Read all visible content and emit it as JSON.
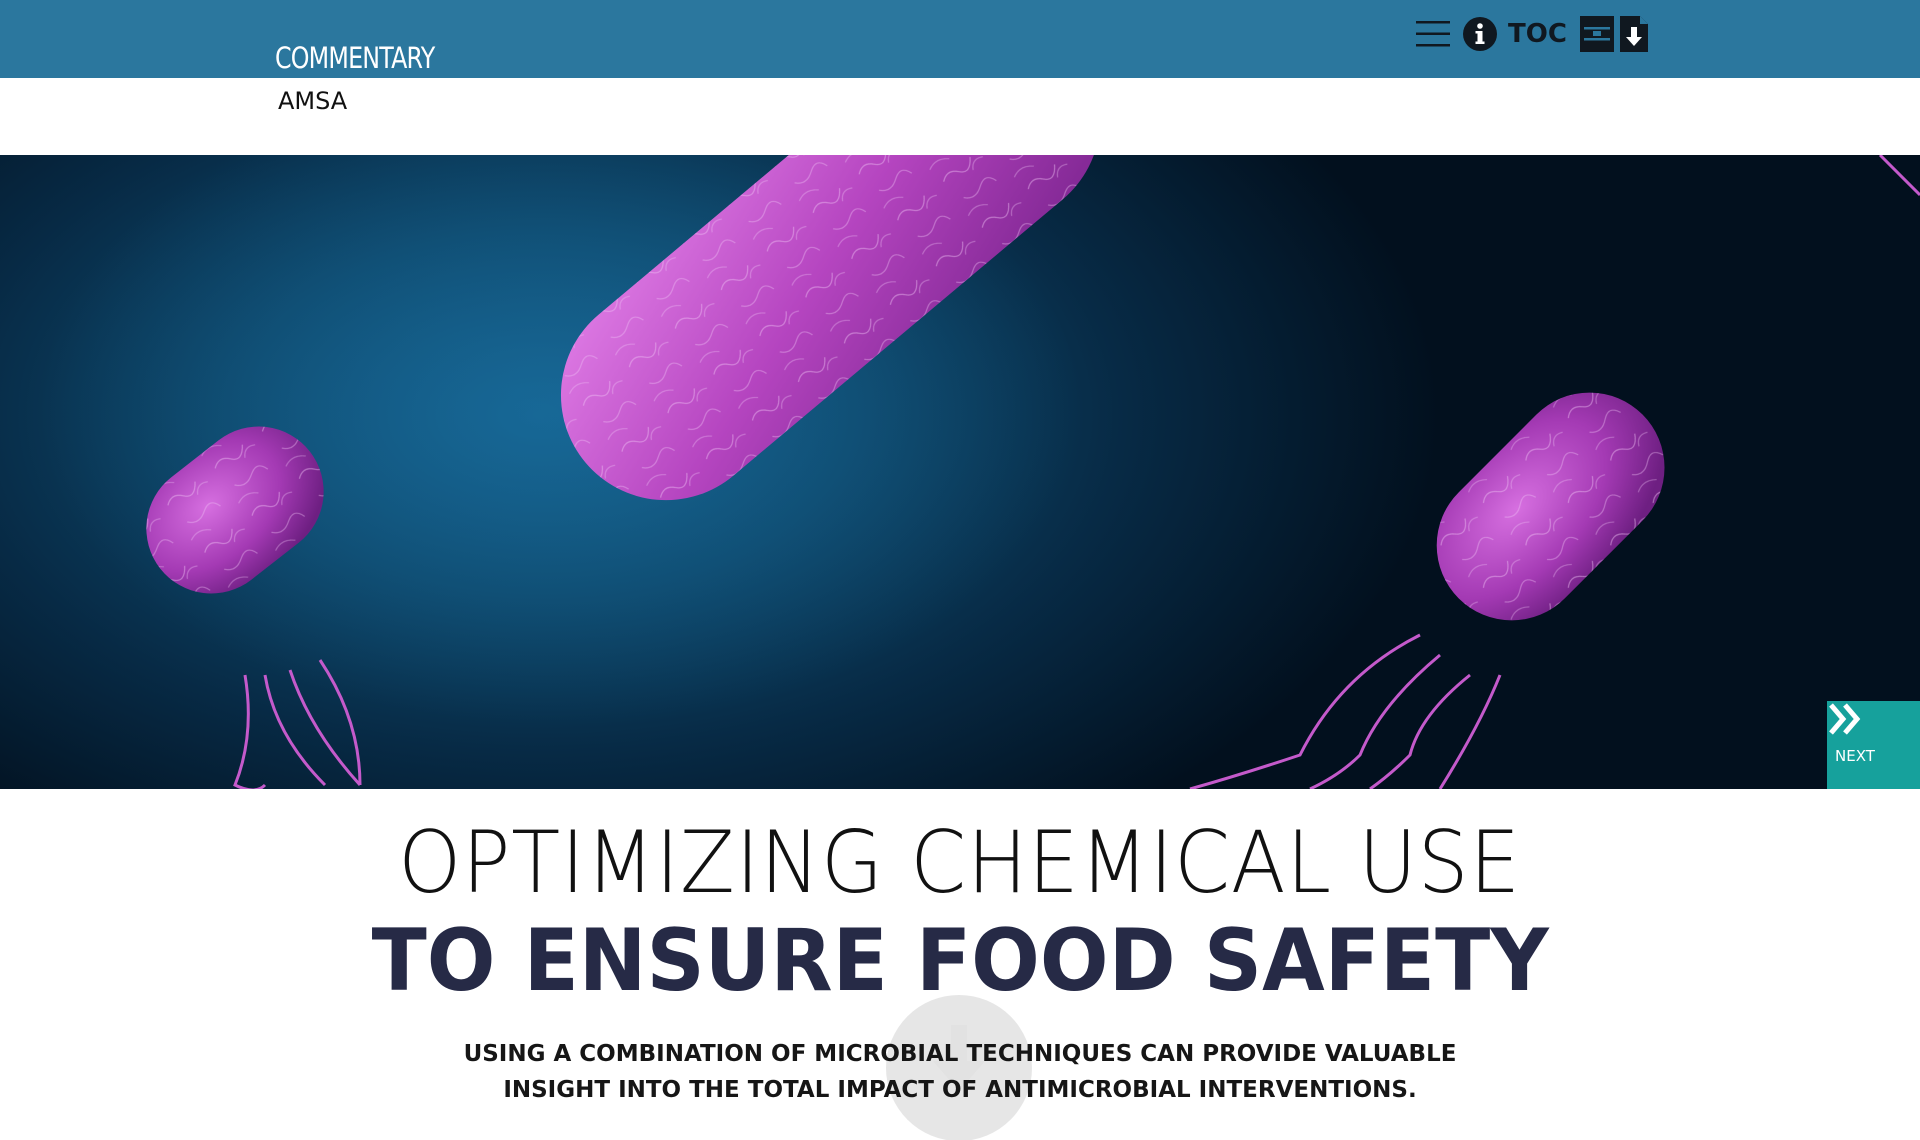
{
  "header": {
    "section_label": "COMMENTARY",
    "publisher": "AMSA",
    "toolbar": {
      "menu_icon": "hamburger-menu-icon",
      "info_icon": "info-icon",
      "toc_label": "TOC",
      "pages_icon": "pages-icon",
      "download_icon": "download-icon"
    }
  },
  "hero": {
    "image": "magenta-bacteria-on-dark-blue-background",
    "next_label": "NEXT",
    "next_icon": "double-chevron-right-icon"
  },
  "article": {
    "title_line1": "OPTIMIZING CHEMICAL USE",
    "title_line2": "TO ENSURE FOOD SAFETY",
    "dek_line1": "USING A COMBINATION OF MICROBIAL TECHNIQUES CAN PROVIDE VALUABLE",
    "dek_line2": "INSIGHT INTO THE TOTAL IMPACT OF ANTIMICROBIAL INTERVENTIONS.",
    "scroll_icon": "scroll-down-arrow-icon"
  },
  "colors": {
    "topbar": "#2b779e",
    "next_button": "#16a19c",
    "title_bold": "#262a46",
    "bacteria": "#c04ccd"
  }
}
